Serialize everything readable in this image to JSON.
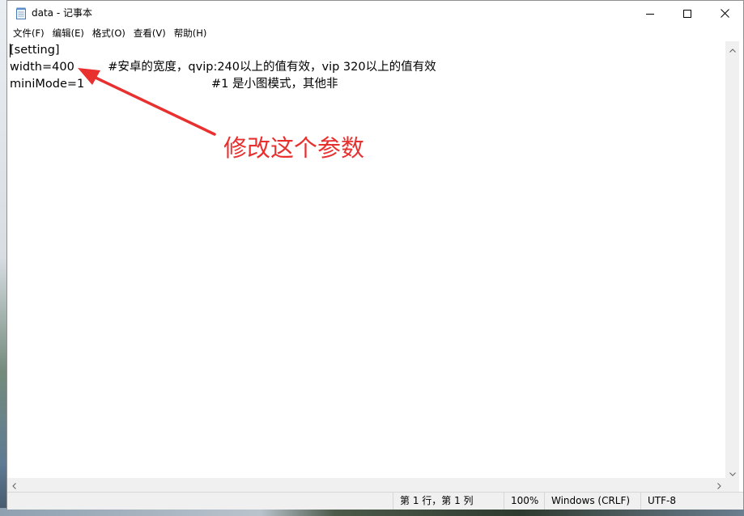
{
  "window": {
    "title": "data - 记事本",
    "icon": "notepad-icon"
  },
  "menu": {
    "items": [
      {
        "label": "文件(F)"
      },
      {
        "label": "编辑(E)"
      },
      {
        "label": "格式(O)"
      },
      {
        "label": "查看(V)"
      },
      {
        "label": "帮助(H)"
      }
    ]
  },
  "editor": {
    "lines": [
      "[setting]",
      "width=400         #安卓的宽度，qvip:240以上的值有效，vip 320以上的值有效",
      "miniMode=1                                  #1 是小图模式，其他非"
    ]
  },
  "status": {
    "position": "第 1 行，第 1 列",
    "zoom": "100%",
    "line_ending": "Windows (CRLF)",
    "encoding": "UTF-8"
  },
  "annotation": {
    "text": "修改这个参数",
    "color": "#e8302f"
  }
}
